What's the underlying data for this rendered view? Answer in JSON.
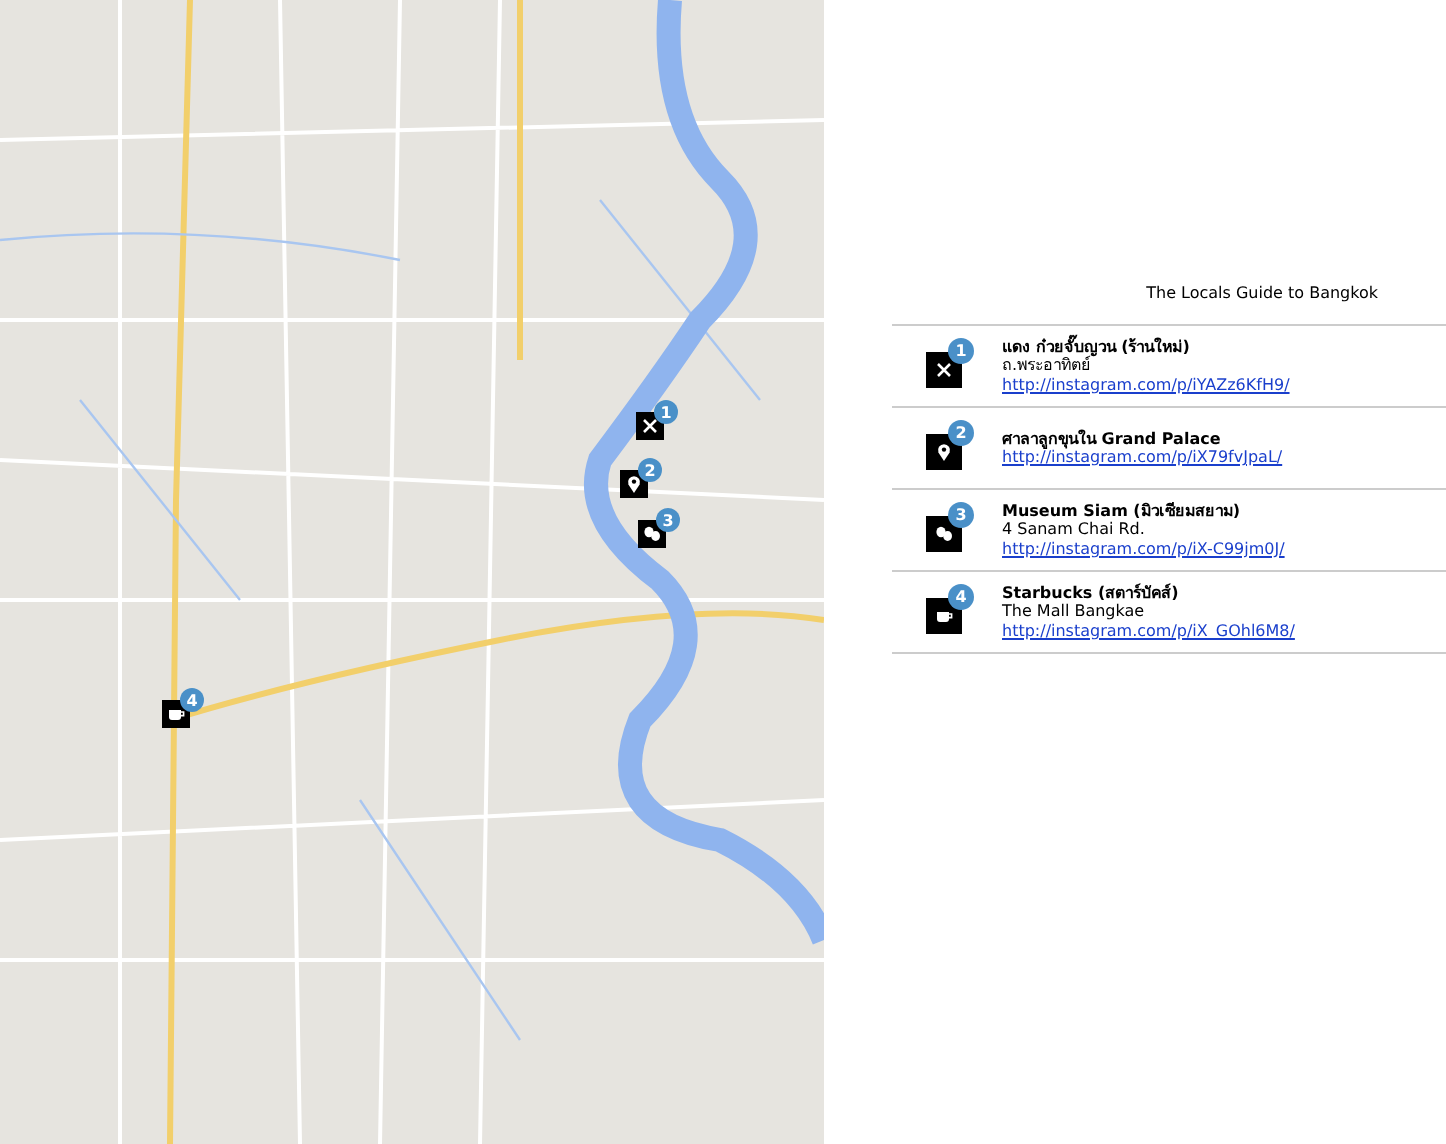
{
  "map_markers": [
    {
      "kind": "restaurant",
      "number": "1"
    },
    {
      "kind": "pin",
      "number": "2"
    },
    {
      "kind": "museum",
      "number": "3"
    },
    {
      "kind": "cafe",
      "number": "4"
    }
  ],
  "title": "The Locals Guide to Bangkok",
  "places": [
    {
      "kind": "restaurant",
      "number": "1",
      "name": "แดง ก๋วยจั๊บญวน (ร้านใหม่)",
      "address": "ถ.พระอาทิตย์",
      "link": "http://instagram.com/p/iYAZz6KfH9/"
    },
    {
      "kind": "pin",
      "number": "2",
      "name": "ศาลาลูกขุนใน Grand Palace",
      "link": "http://instagram.com/p/iX79fvJpaL/"
    },
    {
      "kind": "museum",
      "number": "3",
      "name": "Museum Siam (มิวเซียมสยาม)",
      "address": "4 Sanam Chai Rd.",
      "link": "http://instagram.com/p/iX-C99jm0J/"
    },
    {
      "kind": "cafe",
      "number": "4",
      "name": "Starbucks (สตาร์บัคส์)",
      "address": "The Mall Bangkae",
      "link": "http://instagram.com/p/iX_GOhl6M8/"
    }
  ]
}
